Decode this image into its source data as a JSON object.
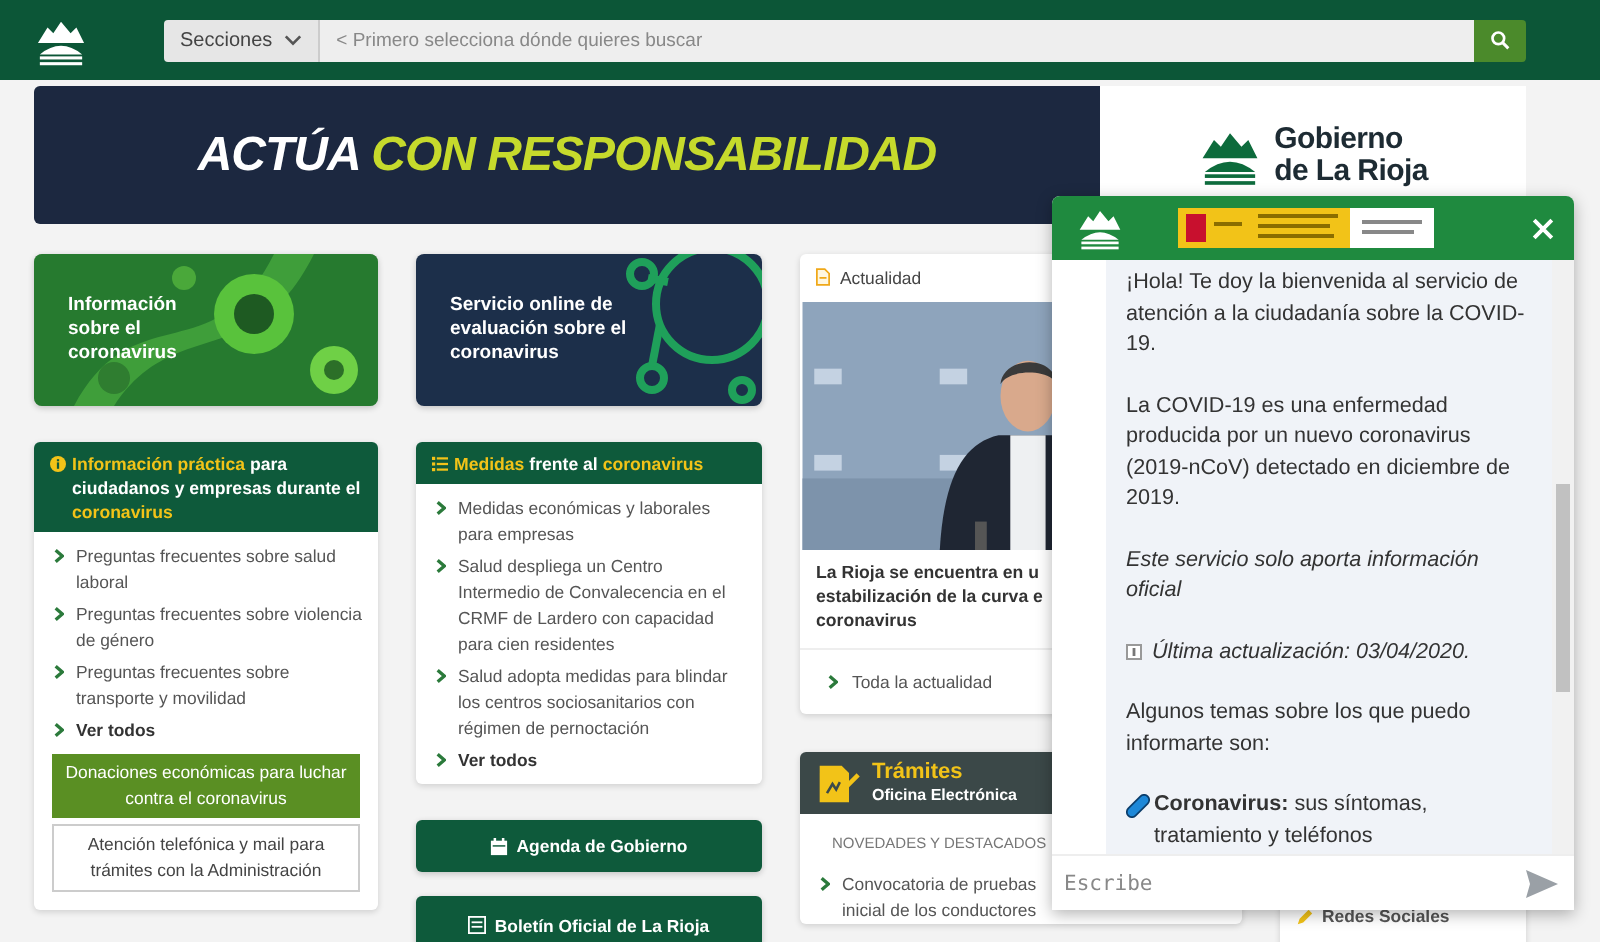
{
  "header": {
    "sections_label": "Secciones",
    "search_placeholder": "< Primero selecciona dónde quieres buscar"
  },
  "banner": {
    "slogan": [
      {
        "text": "ACTÚA ",
        "highlight": false
      },
      {
        "text": "CON RESPONSABILIDAD",
        "highlight": true
      }
    ],
    "brand_lines": [
      "Gobierno",
      "de La Rioja"
    ]
  },
  "tiles": [
    {
      "kind": "picture",
      "label": "Información sobre el coronavirus"
    },
    {
      "kind": "virus",
      "label": "Servicio online de evaluación sobre el coronavirus"
    }
  ],
  "practical_card": {
    "title": [
      {
        "text": "Información práctica",
        "highlight": true
      },
      {
        "text": " para ciudadanos y empresas durante el ",
        "highlight": false
      },
      {
        "text": "coronavirus",
        "highlight": true
      }
    ],
    "links": [
      "Preguntas frecuentes sobre salud laboral",
      "Preguntas frecuentes sobre violencia de género",
      "Preguntas frecuentes sobre transporte y movilidad"
    ],
    "more": "Ver todos",
    "buttons": [
      {
        "kind": "primary",
        "label": "Donaciones económicas para luchar contra el coronavirus"
      },
      {
        "kind": "outline",
        "label": "Atención telefónica y mail para trámites con la Administración"
      }
    ]
  },
  "measures_card": {
    "title": [
      {
        "text": "Medidas",
        "highlight": true
      },
      {
        "text": " frente al ",
        "highlight": false
      },
      {
        "text": "coronavirus",
        "highlight": true
      }
    ],
    "links": [
      "Medidas económicas y laborales para empresas",
      "Salud despliega un Centro Intermedio de Convalecencia en el CRMF de Lardero con capacidad para cien residentes",
      "Salud adopta medidas para blindar los centros sociosanitarios con régimen de pernoctación"
    ],
    "more": "Ver todos"
  },
  "agenda_button": "Agenda de Gobierno",
  "bulletin_button": "Boletín Oficial de La Rioja",
  "news_card": {
    "section": "Actualidad",
    "headline_lines": [
      "La Rioja se encuentra en u",
      "estabilización de la curva e",
      "coronavirus"
    ],
    "more": "Toda la actualidad"
  },
  "procedures_card": {
    "title": "Trámites",
    "subtitle": "Oficina Electrónica",
    "section": "NOVEDADES Y DESTACADOS",
    "item_lines": [
      "Convocatoria de pruebas",
      "inicial de los conductores"
    ]
  },
  "social": {
    "label": "Redes Sociales"
  },
  "chat": {
    "paragraphs": [
      {
        "kind": "text",
        "text": "¡Hola! Te doy la bienvenida al servicio de atención a la ciudadanía sobre la COVID-19."
      },
      {
        "kind": "text",
        "text": "La COVID-19 es una enfermedad producida por un nuevo coronavirus (2019-nCoV) detectado en diciembre de 2019."
      },
      {
        "kind": "note",
        "text": "Este servicio solo aporta información oficial"
      },
      {
        "kind": "update",
        "text": "Última actualización: 03/04/2020."
      },
      {
        "kind": "text",
        "text": "Algunos temas sobre los que puedo informarte son:"
      },
      {
        "kind": "topic",
        "text": "**Coronavirus:** sus síntomas, tratamiento y teléfonos"
      }
    ],
    "placeholder": "Escribe"
  }
}
